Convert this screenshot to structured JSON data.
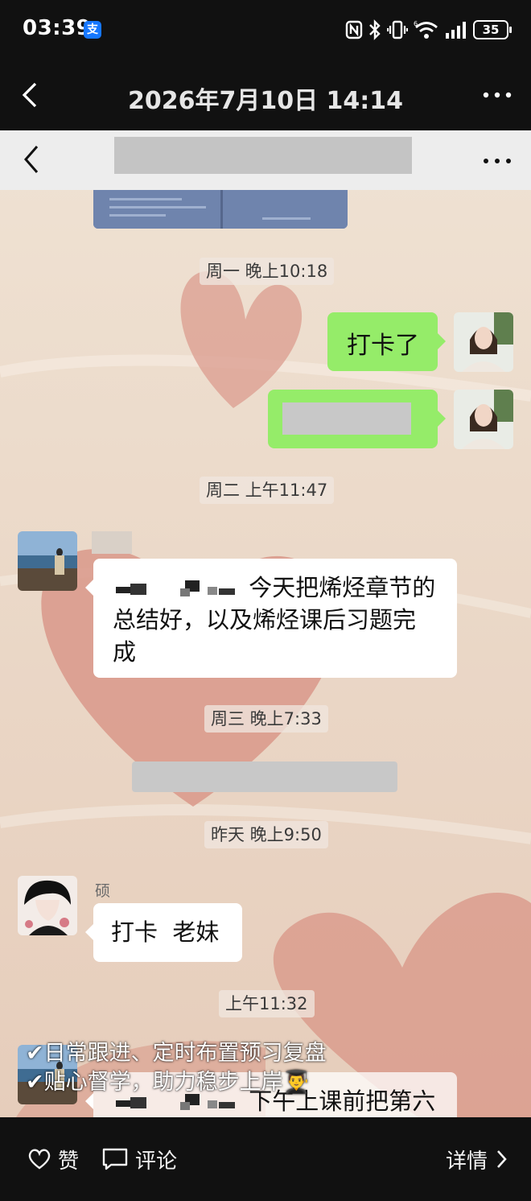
{
  "status_bar": {
    "time": "03:39",
    "app_badge": "支",
    "battery": "35",
    "icons": [
      "nfc-icon",
      "bluetooth-icon",
      "vibrate-icon",
      "wifi-icon",
      "signal-icon",
      "battery-icon"
    ]
  },
  "top_bar": {
    "title": "2026年7月10日 14:14",
    "back_icon": "chevron-left-icon",
    "more_icon": "more-icon"
  },
  "chat": {
    "header": {
      "back_icon": "chevron-left-icon",
      "more_icon": "more-icon"
    },
    "timestamps": {
      "t1": "周一 晚上10:18",
      "t2": "周二 上午11:47",
      "t3": "周三 晚上7:33",
      "t4": "昨天 晚上9:50",
      "t5": "上午11:32"
    },
    "messages": {
      "m1_text": "打卡了",
      "m3_line1": "今天把烯烃章节的",
      "m3_line2": "总结好，以及烯烃课后习题完",
      "m3_line3": "成",
      "m5_sender": "硕",
      "m5_text": "打卡  老妹",
      "m6_partial": "下午上课前把第六"
    },
    "overlay_caption": {
      "line1": "✔日常跟进、定时布置预习复盘",
      "line2": "✔贴心督学，助力稳步上岸👨‍🎓"
    }
  },
  "bottom_bar": {
    "like_label": "赞",
    "comment_label": "评论",
    "detail_label": "详情"
  },
  "colors": {
    "sent_bubble": "#95ec69",
    "received_bubble": "#ffffff",
    "chat_background": "#ecdcc9",
    "heart": "#d9988a",
    "system_bar": "#111111"
  }
}
